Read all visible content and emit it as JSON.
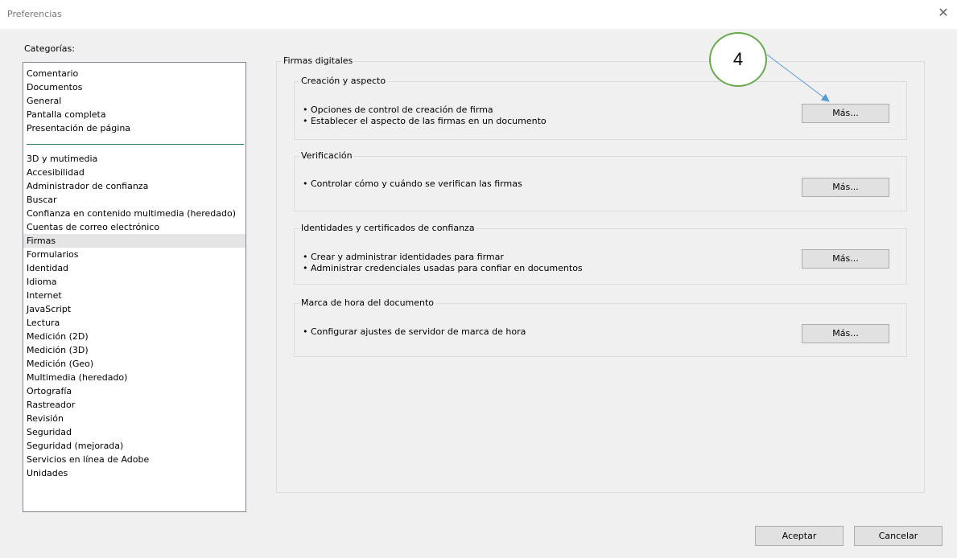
{
  "window": {
    "title": "Preferencias",
    "close_glyph": "✕"
  },
  "categories": {
    "label": "Categorías:",
    "top_items": [
      "Comentario",
      "Documentos",
      "General",
      "Pantalla completa",
      "Presentación de página"
    ],
    "items": [
      "3D y mutimedia",
      "Accesibilidad",
      "Administrador de confianza",
      "Buscar",
      "Confianza en contenido multimedia (heredado)",
      "Cuentas de correo electrónico",
      "Firmas",
      "Formularios",
      "Identidad",
      "Idioma",
      "Internet",
      "JavaScript",
      "Lectura",
      "Medición (2D)",
      "Medición (3D)",
      "Medición (Geo)",
      "Multimedia (heredado)",
      "Ortografía",
      "Rastreador",
      "Revisión",
      "Seguridad",
      "Seguridad (mejorada)",
      "Servicios en línea de Adobe",
      "Unidades"
    ],
    "selected": "Firmas"
  },
  "panel": {
    "title": "Firmas digitales",
    "sections": [
      {
        "title": "Creación y aspecto",
        "bullets": [
          "• Opciones de control de creación de firma",
          "• Establecer el aspecto de las firmas en un documento"
        ],
        "button": "Más..."
      },
      {
        "title": "Verificación",
        "bullets": [
          "• Controlar cómo y cuándo se verifican las firmas"
        ],
        "button": "Más..."
      },
      {
        "title": "Identidades y certificados de confianza",
        "bullets": [
          "• Crear y administrar identidades para firmar",
          "• Administrar credenciales usadas para confiar en documentos"
        ],
        "button": "Más..."
      },
      {
        "title": "Marca de hora del documento",
        "bullets": [
          "• Configurar ajustes de servidor de marca de hora"
        ],
        "button": "Más..."
      }
    ]
  },
  "annotation": {
    "label": "4",
    "circle_color": "#6aa84f",
    "arrow_color": "#5b9bd5"
  },
  "footer": {
    "accept_label": "Aceptar",
    "cancel_label": "Cancelar"
  },
  "colors": {
    "selection": "#e5e5e5",
    "divider": "#2a7a7a"
  }
}
